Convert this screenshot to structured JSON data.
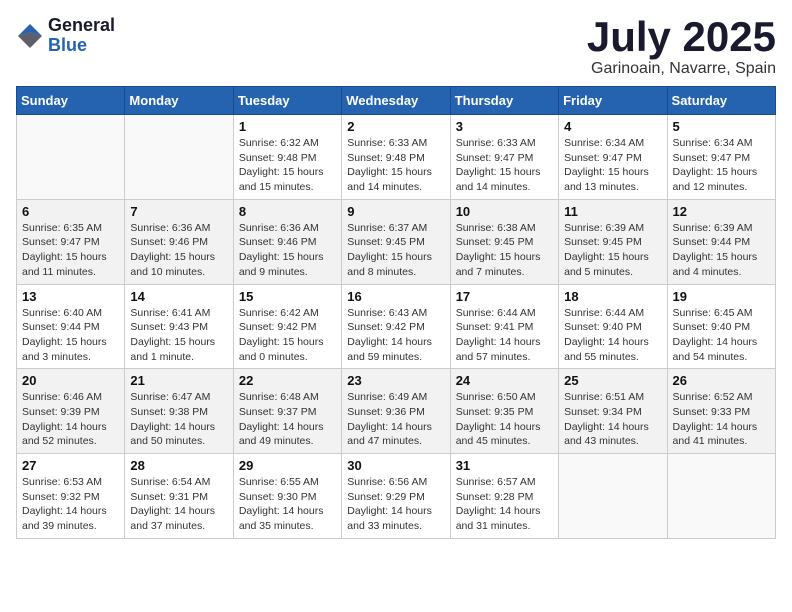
{
  "header": {
    "logo_general": "General",
    "logo_blue": "Blue",
    "month_title": "July 2025",
    "location": "Garinoain, Navarre, Spain"
  },
  "weekdays": [
    "Sunday",
    "Monday",
    "Tuesday",
    "Wednesday",
    "Thursday",
    "Friday",
    "Saturday"
  ],
  "weeks": [
    [
      {
        "day": "",
        "sunrise": "",
        "sunset": "",
        "daylight": ""
      },
      {
        "day": "",
        "sunrise": "",
        "sunset": "",
        "daylight": ""
      },
      {
        "day": "1",
        "sunrise": "Sunrise: 6:32 AM",
        "sunset": "Sunset: 9:48 PM",
        "daylight": "Daylight: 15 hours and 15 minutes."
      },
      {
        "day": "2",
        "sunrise": "Sunrise: 6:33 AM",
        "sunset": "Sunset: 9:48 PM",
        "daylight": "Daylight: 15 hours and 14 minutes."
      },
      {
        "day": "3",
        "sunrise": "Sunrise: 6:33 AM",
        "sunset": "Sunset: 9:47 PM",
        "daylight": "Daylight: 15 hours and 14 minutes."
      },
      {
        "day": "4",
        "sunrise": "Sunrise: 6:34 AM",
        "sunset": "Sunset: 9:47 PM",
        "daylight": "Daylight: 15 hours and 13 minutes."
      },
      {
        "day": "5",
        "sunrise": "Sunrise: 6:34 AM",
        "sunset": "Sunset: 9:47 PM",
        "daylight": "Daylight: 15 hours and 12 minutes."
      }
    ],
    [
      {
        "day": "6",
        "sunrise": "Sunrise: 6:35 AM",
        "sunset": "Sunset: 9:47 PM",
        "daylight": "Daylight: 15 hours and 11 minutes."
      },
      {
        "day": "7",
        "sunrise": "Sunrise: 6:36 AM",
        "sunset": "Sunset: 9:46 PM",
        "daylight": "Daylight: 15 hours and 10 minutes."
      },
      {
        "day": "8",
        "sunrise": "Sunrise: 6:36 AM",
        "sunset": "Sunset: 9:46 PM",
        "daylight": "Daylight: 15 hours and 9 minutes."
      },
      {
        "day": "9",
        "sunrise": "Sunrise: 6:37 AM",
        "sunset": "Sunset: 9:45 PM",
        "daylight": "Daylight: 15 hours and 8 minutes."
      },
      {
        "day": "10",
        "sunrise": "Sunrise: 6:38 AM",
        "sunset": "Sunset: 9:45 PM",
        "daylight": "Daylight: 15 hours and 7 minutes."
      },
      {
        "day": "11",
        "sunrise": "Sunrise: 6:39 AM",
        "sunset": "Sunset: 9:45 PM",
        "daylight": "Daylight: 15 hours and 5 minutes."
      },
      {
        "day": "12",
        "sunrise": "Sunrise: 6:39 AM",
        "sunset": "Sunset: 9:44 PM",
        "daylight": "Daylight: 15 hours and 4 minutes."
      }
    ],
    [
      {
        "day": "13",
        "sunrise": "Sunrise: 6:40 AM",
        "sunset": "Sunset: 9:44 PM",
        "daylight": "Daylight: 15 hours and 3 minutes."
      },
      {
        "day": "14",
        "sunrise": "Sunrise: 6:41 AM",
        "sunset": "Sunset: 9:43 PM",
        "daylight": "Daylight: 15 hours and 1 minute."
      },
      {
        "day": "15",
        "sunrise": "Sunrise: 6:42 AM",
        "sunset": "Sunset: 9:42 PM",
        "daylight": "Daylight: 15 hours and 0 minutes."
      },
      {
        "day": "16",
        "sunrise": "Sunrise: 6:43 AM",
        "sunset": "Sunset: 9:42 PM",
        "daylight": "Daylight: 14 hours and 59 minutes."
      },
      {
        "day": "17",
        "sunrise": "Sunrise: 6:44 AM",
        "sunset": "Sunset: 9:41 PM",
        "daylight": "Daylight: 14 hours and 57 minutes."
      },
      {
        "day": "18",
        "sunrise": "Sunrise: 6:44 AM",
        "sunset": "Sunset: 9:40 PM",
        "daylight": "Daylight: 14 hours and 55 minutes."
      },
      {
        "day": "19",
        "sunrise": "Sunrise: 6:45 AM",
        "sunset": "Sunset: 9:40 PM",
        "daylight": "Daylight: 14 hours and 54 minutes."
      }
    ],
    [
      {
        "day": "20",
        "sunrise": "Sunrise: 6:46 AM",
        "sunset": "Sunset: 9:39 PM",
        "daylight": "Daylight: 14 hours and 52 minutes."
      },
      {
        "day": "21",
        "sunrise": "Sunrise: 6:47 AM",
        "sunset": "Sunset: 9:38 PM",
        "daylight": "Daylight: 14 hours and 50 minutes."
      },
      {
        "day": "22",
        "sunrise": "Sunrise: 6:48 AM",
        "sunset": "Sunset: 9:37 PM",
        "daylight": "Daylight: 14 hours and 49 minutes."
      },
      {
        "day": "23",
        "sunrise": "Sunrise: 6:49 AM",
        "sunset": "Sunset: 9:36 PM",
        "daylight": "Daylight: 14 hours and 47 minutes."
      },
      {
        "day": "24",
        "sunrise": "Sunrise: 6:50 AM",
        "sunset": "Sunset: 9:35 PM",
        "daylight": "Daylight: 14 hours and 45 minutes."
      },
      {
        "day": "25",
        "sunrise": "Sunrise: 6:51 AM",
        "sunset": "Sunset: 9:34 PM",
        "daylight": "Daylight: 14 hours and 43 minutes."
      },
      {
        "day": "26",
        "sunrise": "Sunrise: 6:52 AM",
        "sunset": "Sunset: 9:33 PM",
        "daylight": "Daylight: 14 hours and 41 minutes."
      }
    ],
    [
      {
        "day": "27",
        "sunrise": "Sunrise: 6:53 AM",
        "sunset": "Sunset: 9:32 PM",
        "daylight": "Daylight: 14 hours and 39 minutes."
      },
      {
        "day": "28",
        "sunrise": "Sunrise: 6:54 AM",
        "sunset": "Sunset: 9:31 PM",
        "daylight": "Daylight: 14 hours and 37 minutes."
      },
      {
        "day": "29",
        "sunrise": "Sunrise: 6:55 AM",
        "sunset": "Sunset: 9:30 PM",
        "daylight": "Daylight: 14 hours and 35 minutes."
      },
      {
        "day": "30",
        "sunrise": "Sunrise: 6:56 AM",
        "sunset": "Sunset: 9:29 PM",
        "daylight": "Daylight: 14 hours and 33 minutes."
      },
      {
        "day": "31",
        "sunrise": "Sunrise: 6:57 AM",
        "sunset": "Sunset: 9:28 PM",
        "daylight": "Daylight: 14 hours and 31 minutes."
      },
      {
        "day": "",
        "sunrise": "",
        "sunset": "",
        "daylight": ""
      },
      {
        "day": "",
        "sunrise": "",
        "sunset": "",
        "daylight": ""
      }
    ]
  ]
}
